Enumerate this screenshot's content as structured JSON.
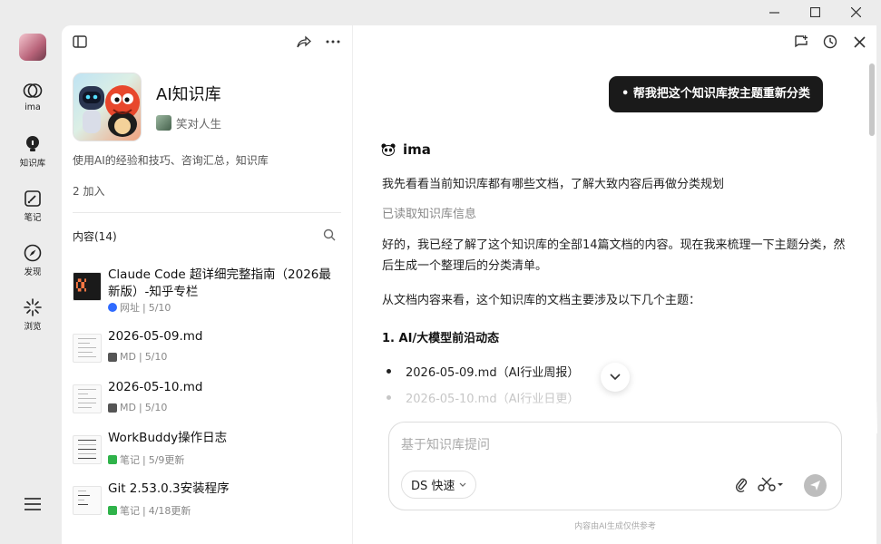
{
  "rail": {
    "items": [
      {
        "label": "ima",
        "icon": "ima-logo-icon"
      },
      {
        "label": "知识库",
        "icon": "lightbulb-icon"
      },
      {
        "label": "笔记",
        "icon": "note-edit-icon"
      },
      {
        "label": "发现",
        "icon": "compass-icon"
      },
      {
        "label": "浏览",
        "icon": "sparkle-browse-icon"
      }
    ]
  },
  "kb": {
    "title": "AI知识库",
    "owner": "笑对人生",
    "description": "使用AI的经验和技巧、咨询汇总，知识库",
    "joined": "2 加入",
    "content_header": "内容(14)",
    "items": [
      {
        "title": "Claude Code 超详细完整指南（2026最新版）-知乎专栏",
        "source": "网址",
        "date": "5/10",
        "icon": "web-source-icon"
      },
      {
        "title": "2026-05-09.md",
        "source": "MD",
        "date": "5/10",
        "icon": "markdown-icon"
      },
      {
        "title": "2026-05-10.md",
        "source": "MD",
        "date": "5/10",
        "icon": "markdown-icon"
      },
      {
        "title": "WorkBuddy操作日志",
        "source": "笔记",
        "date": "5/9更新",
        "icon": "note-icon"
      },
      {
        "title": "Git 2.53.0.3安装程序",
        "source": "笔记",
        "date": "4/18更新",
        "icon": "note-icon"
      }
    ]
  },
  "chat": {
    "user_prompt": "• 帮我把这个知识库按主题重新分类",
    "bot_name": "ima",
    "intro": "我先看看当前知识库都有哪些文档，了解大致内容后再做分类规划",
    "status": "已读取知识库信息",
    "summary": "好的，我已经了解了这个知识库的全部14篇文档的内容。现在我来梳理一下主题分类，然后生成一个整理后的分类清单。",
    "lead": "从文档内容来看，这个知识库的文档主要涉及以下几个主题：",
    "section_title": "1. AI/大模型前沿动态",
    "bullets": [
      "2026-05-09.md（AI行业周报）",
      "2026-05-10.md（AI行业日更）"
    ],
    "input_placeholder": "基于知识库提问",
    "model_label": "DS 快速",
    "footnote": "内容由AI生成仅供参考"
  },
  "colors": {
    "accent_dark": "#1a1a1a",
    "note_green": "#2fb34a",
    "web_blue": "#2f6bff"
  }
}
